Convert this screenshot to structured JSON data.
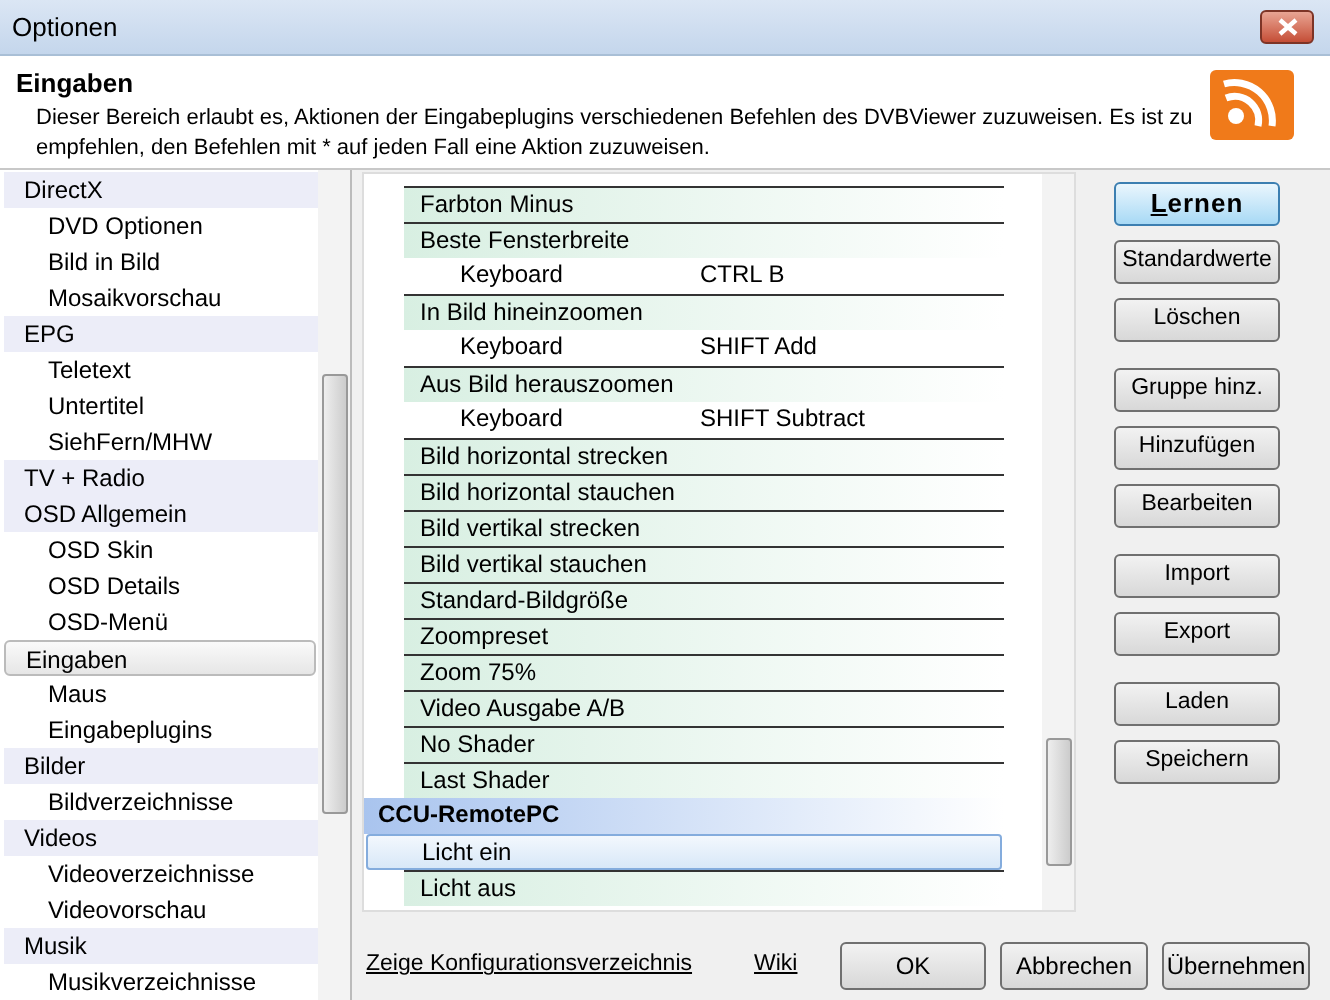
{
  "window": {
    "title": "Optionen"
  },
  "header": {
    "title": "Eingaben",
    "description": "Dieser Bereich erlaubt es, Aktionen der Eingabeplugins verschiedenen Befehlen des DVBViewer zuzuweisen. Es ist zu empfehlen, den Befehlen mit * auf jeden Fall eine Aktion zuzuweisen."
  },
  "sidebar": {
    "items": [
      {
        "label": "DirectX",
        "kind": "group",
        "selected": false
      },
      {
        "label": "DVD Optionen",
        "kind": "child",
        "selected": false
      },
      {
        "label": "Bild in Bild",
        "kind": "child",
        "selected": false
      },
      {
        "label": "Mosaikvorschau",
        "kind": "child",
        "selected": false
      },
      {
        "label": "EPG",
        "kind": "group",
        "selected": false
      },
      {
        "label": "Teletext",
        "kind": "child",
        "selected": false
      },
      {
        "label": "Untertitel",
        "kind": "child",
        "selected": false
      },
      {
        "label": "SiehFern/MHW",
        "kind": "child",
        "selected": false
      },
      {
        "label": "TV + Radio",
        "kind": "group",
        "selected": false
      },
      {
        "label": "OSD Allgemein",
        "kind": "group",
        "selected": false
      },
      {
        "label": "OSD Skin",
        "kind": "child",
        "selected": false
      },
      {
        "label": "OSD Details",
        "kind": "child",
        "selected": false
      },
      {
        "label": "OSD-Menü",
        "kind": "child",
        "selected": false
      },
      {
        "label": "Eingaben",
        "kind": "group",
        "selected": true
      },
      {
        "label": "Maus",
        "kind": "child",
        "selected": false
      },
      {
        "label": "Eingabeplugins",
        "kind": "child",
        "selected": false
      },
      {
        "label": "Bilder",
        "kind": "group",
        "selected": false
      },
      {
        "label": "Bildverzeichnisse",
        "kind": "child",
        "selected": false
      },
      {
        "label": "Videos",
        "kind": "group",
        "selected": false
      },
      {
        "label": "Videoverzeichnisse",
        "kind": "child",
        "selected": false
      },
      {
        "label": "Videovorschau",
        "kind": "child",
        "selected": false
      },
      {
        "label": "Musik",
        "kind": "group",
        "selected": false
      },
      {
        "label": "Musikverzeichnisse",
        "kind": "child",
        "selected": false
      }
    ]
  },
  "commands": {
    "rows": [
      {
        "kind": "command",
        "label": "Farbton Minus",
        "selected": false
      },
      {
        "kind": "command",
        "label": "Beste Fensterbreite",
        "selected": false
      },
      {
        "kind": "binding",
        "label": "Keyboard",
        "value": "CTRL B",
        "selected": false
      },
      {
        "kind": "command",
        "label": "In Bild hineinzoomen",
        "selected": false
      },
      {
        "kind": "binding",
        "label": "Keyboard",
        "value": "SHIFT Add",
        "selected": false
      },
      {
        "kind": "command",
        "label": "Aus Bild herauszoomen",
        "selected": false
      },
      {
        "kind": "binding",
        "label": "Keyboard",
        "value": "SHIFT Subtract",
        "selected": false
      },
      {
        "kind": "command",
        "label": "Bild horizontal strecken",
        "selected": false
      },
      {
        "kind": "command",
        "label": "Bild horizontal stauchen",
        "selected": false
      },
      {
        "kind": "command",
        "label": "Bild vertikal strecken",
        "selected": false
      },
      {
        "kind": "command",
        "label": "Bild vertikal stauchen",
        "selected": false
      },
      {
        "kind": "command",
        "label": "Standard-Bildgröße",
        "selected": false
      },
      {
        "kind": "command",
        "label": "Zoompreset",
        "selected": false
      },
      {
        "kind": "command",
        "label": "Zoom 75%",
        "selected": false
      },
      {
        "kind": "command",
        "label": "Video Ausgabe A/B",
        "selected": false
      },
      {
        "kind": "command",
        "label": "No Shader",
        "selected": false
      },
      {
        "kind": "command",
        "label": "Last Shader",
        "selected": false
      },
      {
        "kind": "group",
        "label": "CCU-RemotePC",
        "selected": false
      },
      {
        "kind": "command",
        "label": "Licht ein",
        "selected": true
      },
      {
        "kind": "command",
        "label": "Licht aus",
        "selected": false
      }
    ]
  },
  "side_button_groups": [
    [
      {
        "label": "Lernen",
        "default": true
      },
      {
        "label": "Standardwerte",
        "default": false
      },
      {
        "label": "Löschen",
        "default": false
      }
    ],
    [
      {
        "label": "Gruppe hinz.",
        "default": false
      },
      {
        "label": "Hinzufügen",
        "default": false
      },
      {
        "label": "Bearbeiten",
        "default": false
      }
    ],
    [
      {
        "label": "Import",
        "default": false
      },
      {
        "label": "Export",
        "default": false
      }
    ],
    [
      {
        "label": "Laden",
        "default": false
      },
      {
        "label": "Speichern",
        "default": false
      }
    ]
  ],
  "links": [
    "Zeige Konfigurationsverzeichnis",
    "Wiki"
  ],
  "buttons": [
    "OK",
    "Abbrechen",
    "Übernehmen"
  ]
}
